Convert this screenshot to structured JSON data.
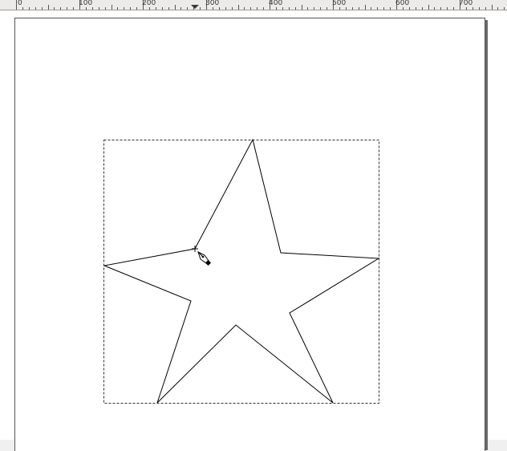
{
  "ruler": {
    "labels": [
      "0",
      "100",
      "200",
      "300",
      "400",
      "500",
      "600",
      "700"
    ]
  },
  "canvas": {
    "shape": "star",
    "star_points": 5,
    "stroke_color": "#000000",
    "fill_color": "none",
    "selection_style": "dashed"
  },
  "tool": {
    "active": "pen-tool",
    "cursor_icon": "pen-cursor-icon"
  }
}
